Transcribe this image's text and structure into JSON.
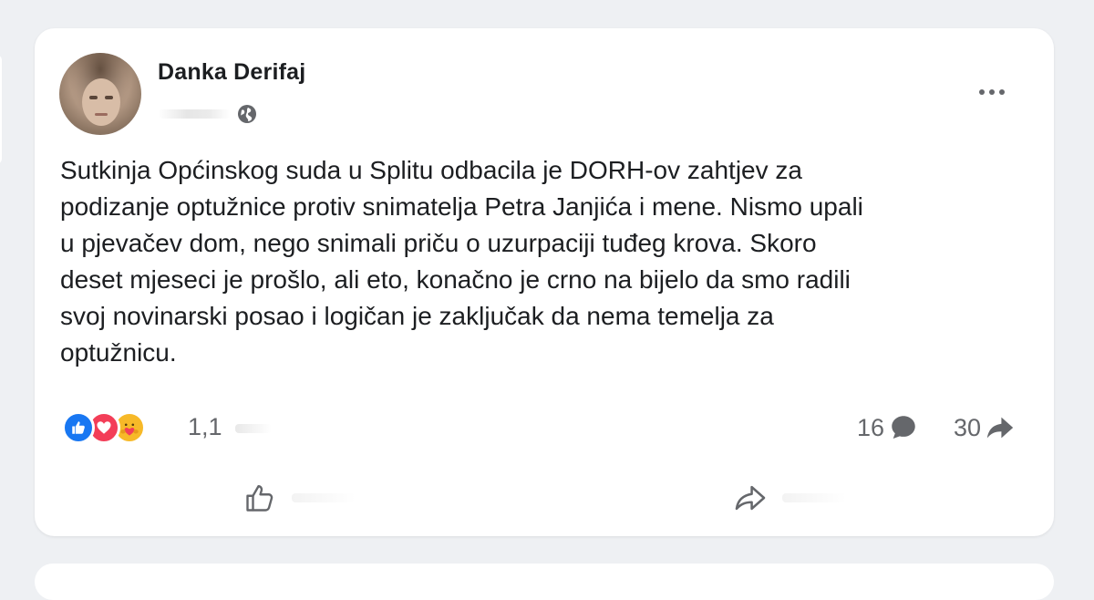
{
  "post": {
    "author": "Danka Derifaj",
    "audience_icon": "globe-icon",
    "text": "Sutkinja Općinskog suda u Splitu odbacila je DORH-ov zahtjev za\npodizanje optužnice protiv snimatelja Petra Janjića i mene. Nismo upali\nu pjevačev dom, nego snimali priču o uzurpaciji tuđeg krova. Skoro\ndeset mjeseci je prošlo, ali eto, konačno je crno na bijelo da smo radili\nsvoj novinarski posao i logičan je zaključak da nema temelja za\noptužnicu."
  },
  "reactions": {
    "icons": [
      "like-reaction-icon",
      "love-reaction-icon",
      "care-reaction-icon"
    ],
    "count": "1,1",
    "comments": "16",
    "shares": "30"
  },
  "actions": {
    "like_icon": "thumbs-up-icon",
    "share_icon": "share-arrow-icon"
  },
  "colors": {
    "like_blue": "#1877f2",
    "love_red": "#f33e58",
    "care_yellow": "#f7b928",
    "secondary_text": "#65676b",
    "primary_text": "#1c1e21"
  }
}
